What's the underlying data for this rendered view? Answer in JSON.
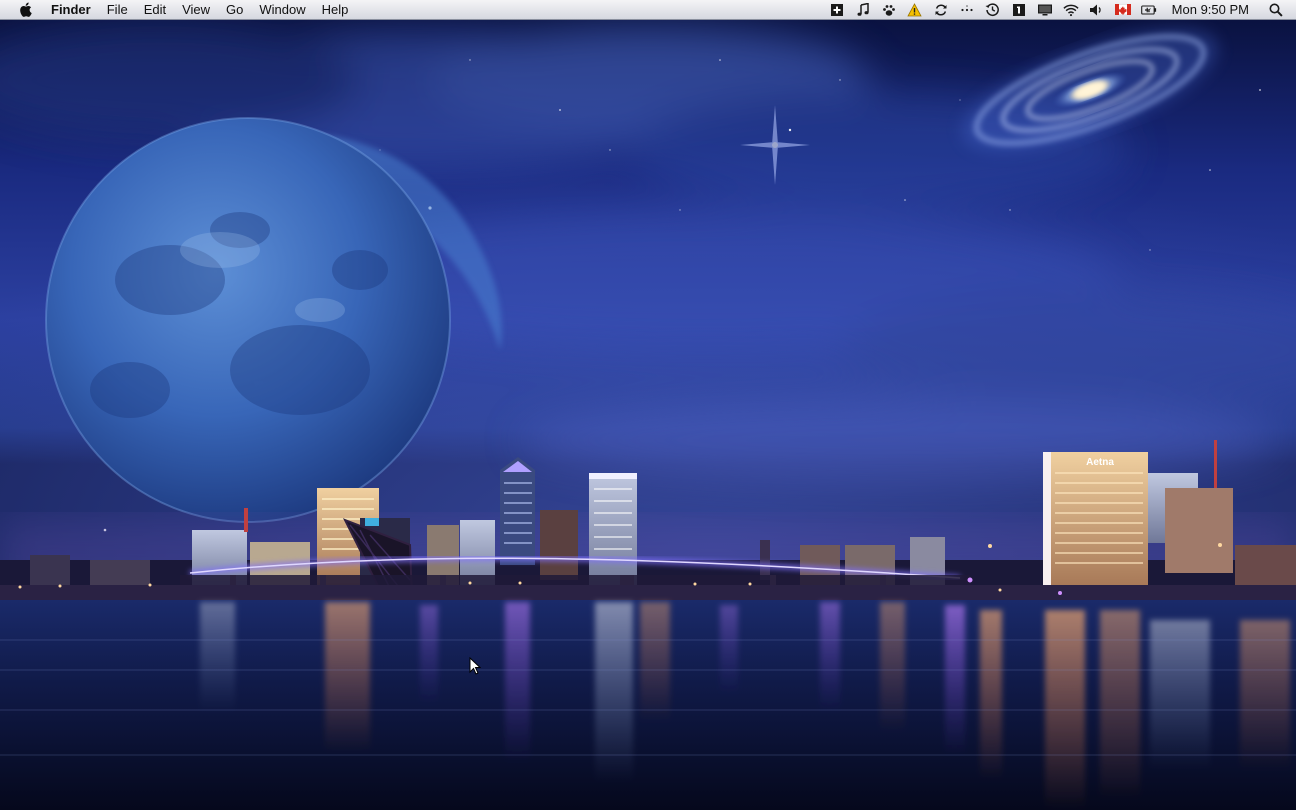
{
  "menubar": {
    "apple_icon": "apple-logo-icon",
    "app_name": "Finder",
    "menus": [
      "File",
      "Edit",
      "View",
      "Go",
      "Window",
      "Help"
    ],
    "status_icons": [
      "plus-box-icon",
      "music-note-icon",
      "paw-icon",
      "warning-icon",
      "sync-icon",
      "dots-icon",
      "time-machine-icon",
      "spaces-icon",
      "display-icon",
      "wifi-icon",
      "volume-icon",
      "canada-flag-icon",
      "battery-icon"
    ],
    "clock": "Mon 9:50 PM",
    "search_icon": "spotlight-search-icon"
  },
  "wallpaper": {
    "billboard_text": "Aetna"
  },
  "colors": {
    "sky_top": "#0b1448",
    "sky_mid": "#2a3f9a",
    "water": "#0a0f2a",
    "bridge_light": "#9a7dff",
    "menubar": "#e6e7ec"
  }
}
